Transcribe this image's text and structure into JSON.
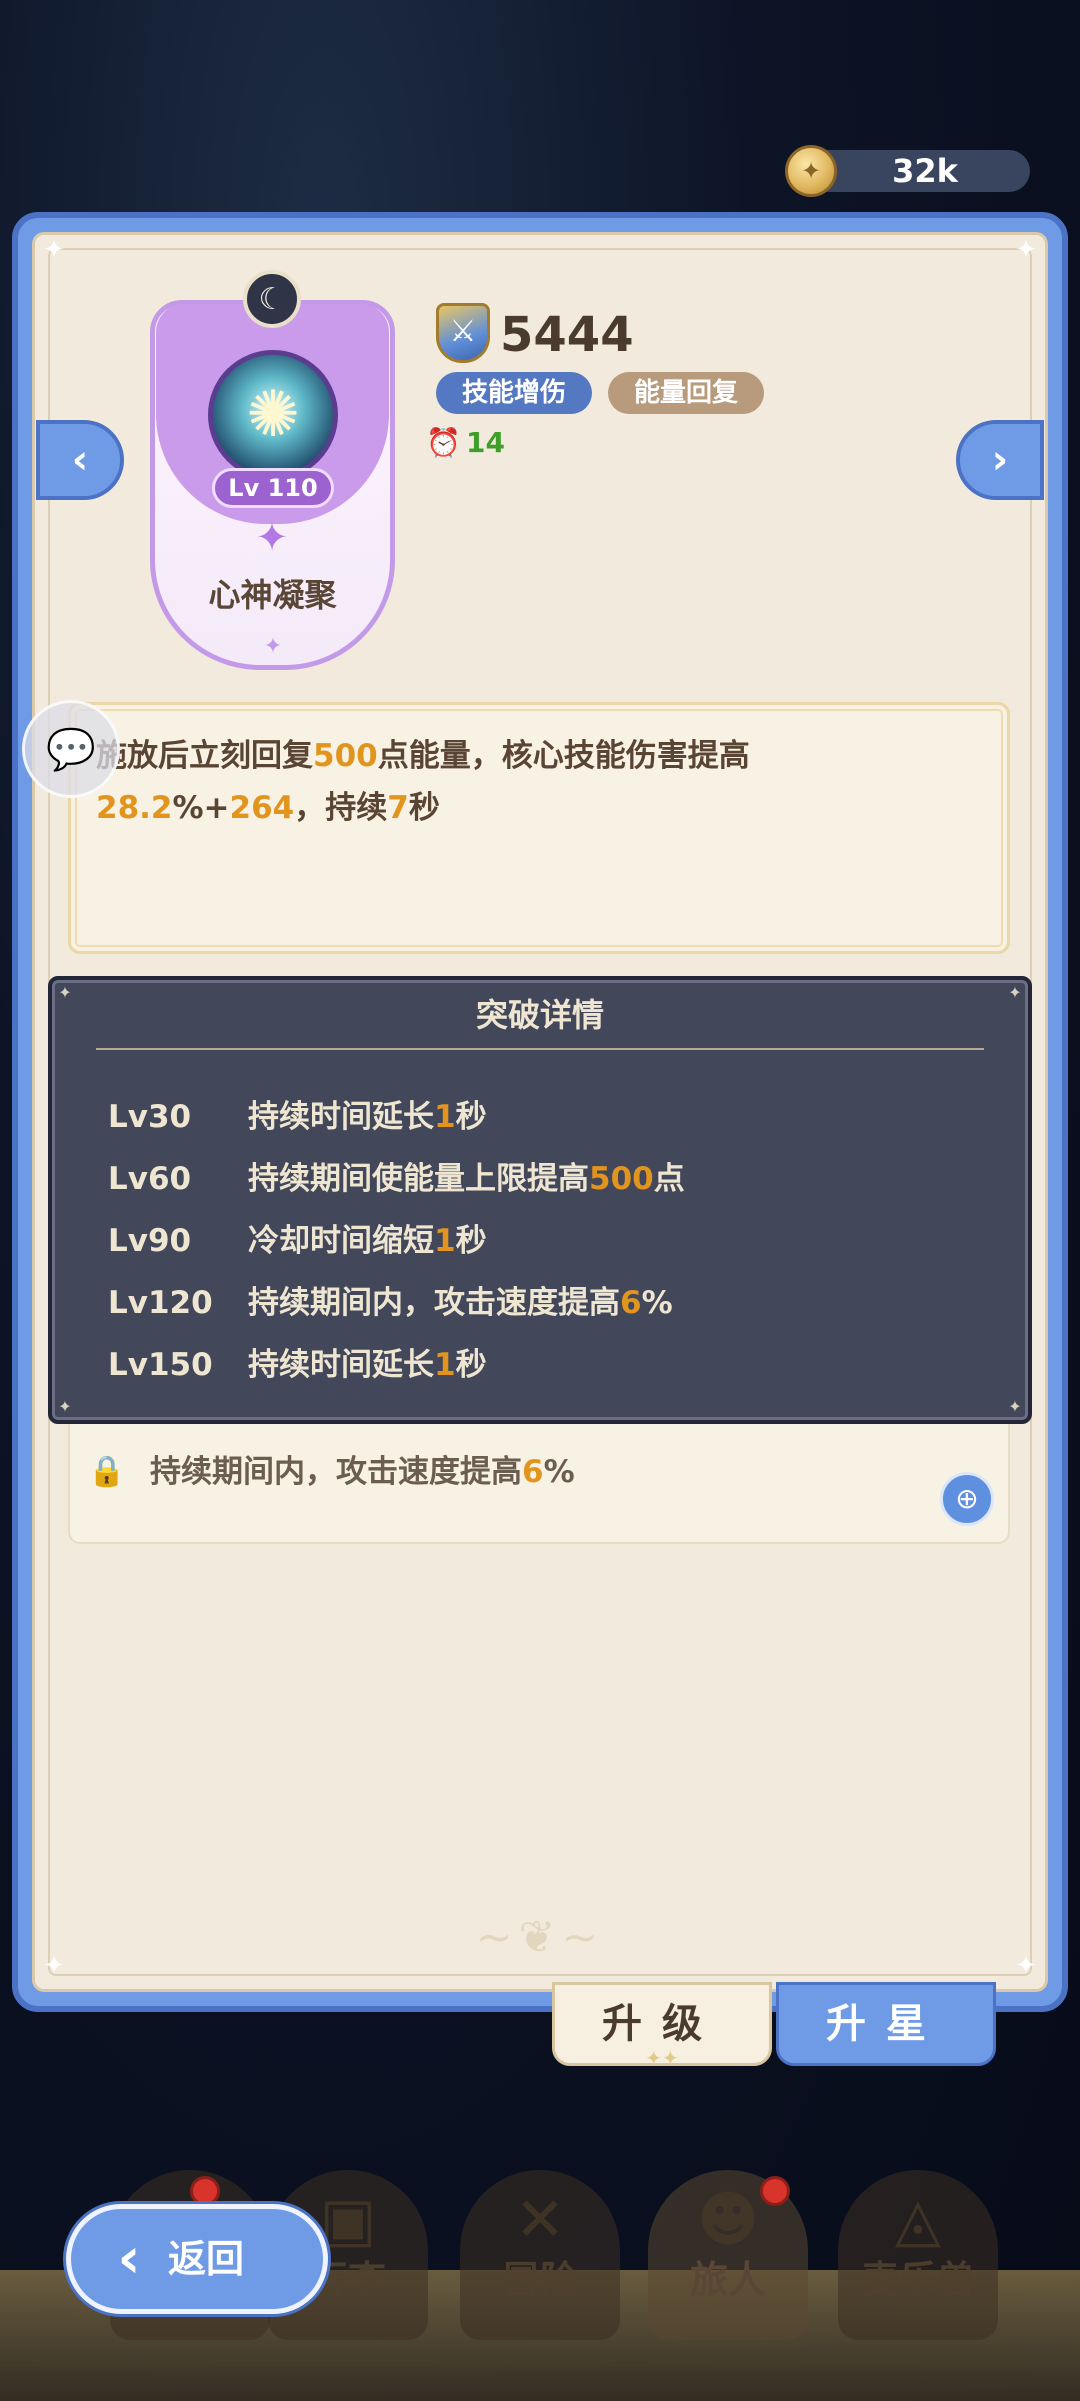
{
  "currency": {
    "icon": "coin-icon",
    "value": "32k"
  },
  "skill": {
    "level": "Lv 110",
    "name": "心神凝聚",
    "power": "5444",
    "tags": [
      "技能增伤",
      "能量回复"
    ],
    "cooldown": "14",
    "description": {
      "p1": "施放后立刻回复",
      "v1": "500",
      "p2": "点能量，核心技能伤害提高",
      "v2": "28.2",
      "p3": "%+",
      "v3": "264",
      "p4": "，持续",
      "v4": "7",
      "p5": "秒"
    }
  },
  "breakthrough": {
    "title": "突破详情",
    "rows": [
      {
        "level": "Lv30",
        "pre": "持续时间延长",
        "val": "1",
        "post": "秒"
      },
      {
        "level": "Lv60",
        "pre": "持续期间使能量上限提高",
        "val": "500",
        "post": "点"
      },
      {
        "level": "Lv90",
        "pre": "冷却时间缩短",
        "val": "1",
        "post": "秒"
      },
      {
        "level": "Lv120",
        "pre": "持续期间内，攻击速度提高",
        "val": "6",
        "post": "%"
      },
      {
        "level": "Lv150",
        "pre": "持续时间延长",
        "val": "1",
        "post": "秒"
      }
    ]
  },
  "locked_effect": {
    "pre": "持续期间内，攻击速度提高",
    "val": "6",
    "post": "%"
  },
  "actions": {
    "upgrade": "升级",
    "star_up": "升星"
  },
  "nav": {
    "back": "返回",
    "items": [
      "行李",
      "冒险",
      "旅人",
      "麦乐兽"
    ]
  },
  "colors": {
    "accent_blue": "#6f9be6",
    "highlight": "#e1951f",
    "cooldown_green": "#3f9e2a",
    "panel_bg": "#f2ebdd",
    "overlay_bg": "#3a3f54"
  }
}
